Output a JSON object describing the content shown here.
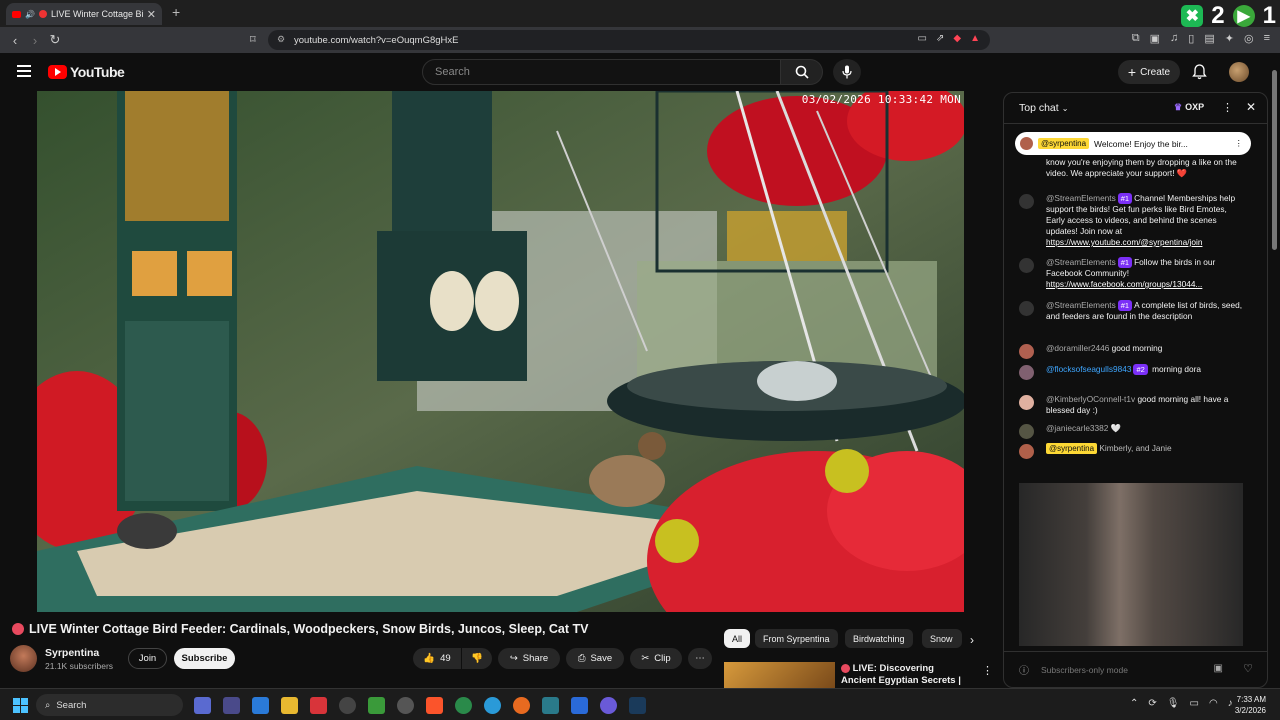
{
  "browser": {
    "tab_title": "LIVE Winter Cottage Bird Fe",
    "url": "youtube.com/watch?v=eOuqmG8gHxE",
    "corner_count_1": "2",
    "corner_count_2": "1"
  },
  "youtube": {
    "logo_text": "YouTube",
    "search_placeholder": "Search",
    "create_label": "Create"
  },
  "video": {
    "timestamp": "03/02/2026 10:33:42 MON",
    "title": "LIVE Winter Cottage Bird Feeder: Cardinals, Woodpeckers, Snow Birds, Juncos, Sleep, Cat TV",
    "channel": "Syrpentina",
    "subscribers": "21.1K subscribers",
    "join_label": "Join",
    "subscribe_label": "Subscribe",
    "likes": "49",
    "share_label": "Share",
    "save_label": "Save",
    "clip_label": "Clip"
  },
  "chips": [
    "All",
    "From Syrpentina",
    "Birdwatching",
    "Snow"
  ],
  "recommendation": {
    "title": "LIVE: Discovering Ancient Egyptian Secrets | Lost ..."
  },
  "chat": {
    "header": "Top chat",
    "oxp": "OXP",
    "pinned_user": "@syrpentina",
    "pinned_text": "Welcome! Enjoy the bir...",
    "messages": [
      {
        "user": "",
        "badge": "",
        "text": "know you're enjoying them by dropping a like on the video. We appreciate your support! ❤️",
        "link": ""
      },
      {
        "user": "@StreamElements",
        "badge": "#1",
        "text": "Channel Memberships help support the birds! Get fun perks like Bird Emotes, Early access to videos, and behind the scenes updates! Join now at ",
        "link": "https://www.youtube.com/@syrpentina/join"
      },
      {
        "user": "@StreamElements",
        "badge": "#1",
        "text": "Follow the birds in our Facebook Community! ",
        "link": "https://www.facebook.com/groups/13044..."
      },
      {
        "user": "@StreamElements",
        "badge": "#1",
        "text": "A complete list of birds, seed, and feeders are found in the description",
        "link": ""
      },
      {
        "user": "@doramiller2446",
        "badge": "",
        "text": "good morning",
        "link": ""
      },
      {
        "user": "@flocksofseagulls9843",
        "badge": "#2",
        "text": "morning dora",
        "link": ""
      },
      {
        "user": "@KimberlyOConnell-t1v",
        "badge": "",
        "text": "good morning all! have a blessed day :)",
        "link": ""
      },
      {
        "user": "@janiecarle3382",
        "badge": "",
        "text": "🤍",
        "link": ""
      },
      {
        "user": "@syrpentina",
        "badge": "",
        "text": "Kimberly, and Janie",
        "link": ""
      }
    ],
    "input_placeholder": "Subscribers-only mode"
  },
  "taskbar": {
    "search_label": "Search",
    "time": "7:33 AM",
    "date": "3/2/2026"
  }
}
